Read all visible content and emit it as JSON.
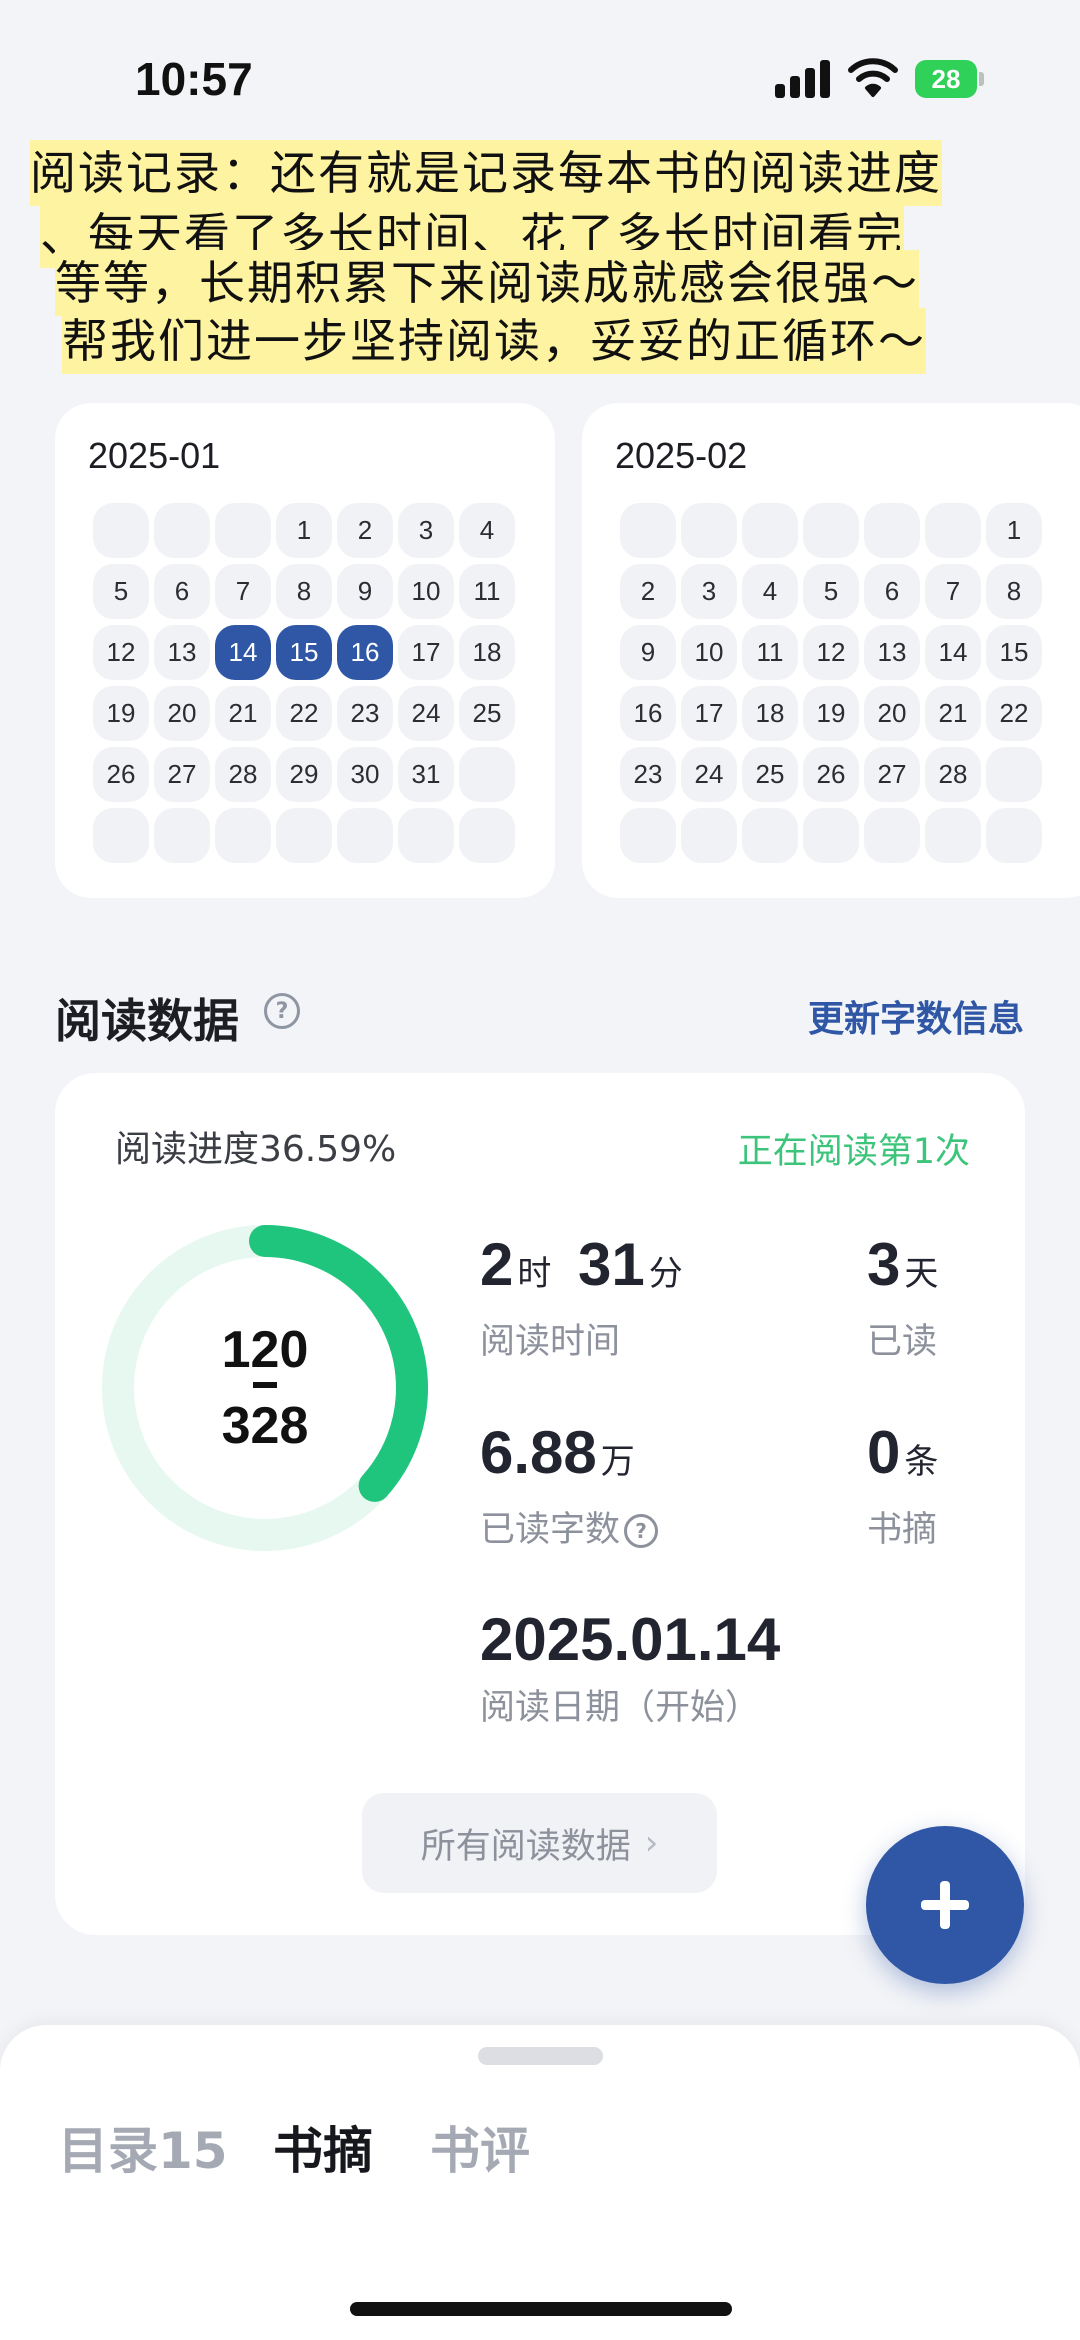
{
  "status_bar": {
    "time": "10:57",
    "battery": "28"
  },
  "annotation": {
    "lines": [
      "阅读记录：还有就是记录每本书的阅读进度",
      "、每天看了多长时间、花了多长时间看完",
      "等等，长期积累下来阅读成就感会很强～",
      "帮我们进一步坚持阅读，妥妥的正循环～"
    ]
  },
  "calendars": [
    {
      "title": "2025-01",
      "cells": [
        "",
        "",
        "",
        "1",
        "2",
        "3",
        "4",
        "5",
        "6",
        "7",
        "8",
        "9",
        "10",
        "11",
        "12",
        "13",
        "14",
        "15",
        "16",
        "17",
        "18",
        "19",
        "20",
        "21",
        "22",
        "23",
        "24",
        "25",
        "26",
        "27",
        "28",
        "29",
        "30",
        "31",
        "",
        "",
        "",
        "",
        "",
        "",
        "",
        ""
      ],
      "highlighted": [
        "14",
        "15",
        "16"
      ]
    },
    {
      "title": "2025-02",
      "cells": [
        "",
        "",
        "",
        "",
        "",
        "",
        "1",
        "2",
        "3",
        "4",
        "5",
        "6",
        "7",
        "8",
        "9",
        "10",
        "11",
        "12",
        "13",
        "14",
        "15",
        "16",
        "17",
        "18",
        "19",
        "20",
        "21",
        "22",
        "23",
        "24",
        "25",
        "26",
        "27",
        "28",
        "",
        "",
        "",
        "",
        "",
        "",
        "",
        ""
      ],
      "highlighted": []
    }
  ],
  "reading_data": {
    "title": "阅读数据",
    "update_link": "更新字数信息",
    "progress_label": "阅读进度36.59%",
    "progress_fraction": 0.3659,
    "reading_count": "正在阅读第1次",
    "pages_read": "120",
    "pages_total": "328",
    "time": {
      "hours": "2",
      "hours_unit": "时",
      "minutes": "31",
      "minutes_unit": "分",
      "label": "阅读时间"
    },
    "days": {
      "value": "3",
      "unit": "天",
      "label": "已读"
    },
    "words": {
      "value": "6.88",
      "unit": "万",
      "label": "已读字数"
    },
    "notes": {
      "value": "0",
      "unit": "条",
      "label": "书摘"
    },
    "start_date": {
      "value": "2025.01.14",
      "label": "阅读日期（开始）"
    },
    "all_button": "所有阅读数据",
    "colors": {
      "accent": "#2f57a6",
      "progress": "#1fc47d",
      "track": "#e6f8f0"
    }
  },
  "bottom_sheet": {
    "tabs": [
      "目录15",
      "书摘",
      "书评"
    ],
    "active_tab": "书摘"
  }
}
